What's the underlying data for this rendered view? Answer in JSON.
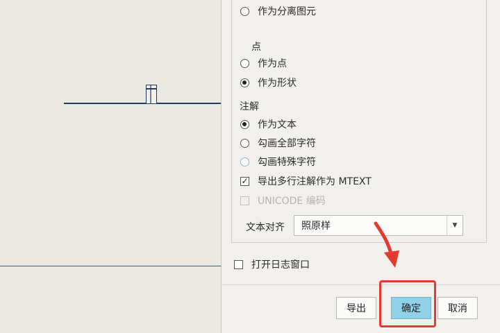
{
  "options": {
    "as_separate_entity": "作为分离图元",
    "points_heading": "点",
    "as_point": "作为点",
    "as_shape": "作为形状",
    "annotation_heading": "注解",
    "as_text": "作为文本",
    "outline_all_chars": "勾画全部字符",
    "outline_special_chars": "勾画特殊字符",
    "export_mtext": "导出多行注解作为 MTEXT",
    "unicode_encoding": "UNICODE 编码",
    "text_align_label": "文本对齐",
    "text_align_value": "照原样",
    "open_log_window": "打开日志窗口"
  },
  "buttons": {
    "export": "导出",
    "ok": "确定",
    "cancel": "取消"
  },
  "state": {
    "points_selected": "as_shape",
    "annotation_selected": "as_text",
    "export_mtext_checked": true,
    "unicode_enabled": false,
    "open_log_checked": false
  },
  "colors": {
    "highlight": "#e23a2e",
    "arrow": "#e23a2e",
    "primary_button": "#8fd1e6"
  }
}
